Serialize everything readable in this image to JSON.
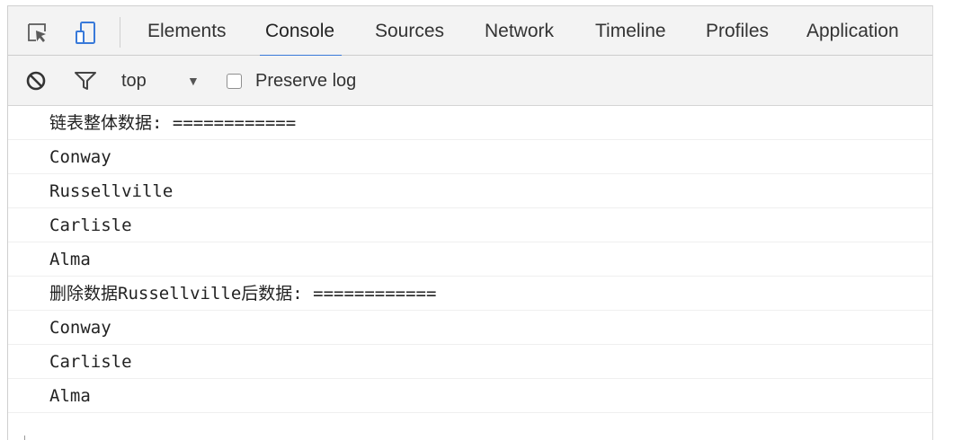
{
  "tabbar": {
    "tabs": [
      {
        "label": "Elements",
        "active": false
      },
      {
        "label": "Console",
        "active": true
      },
      {
        "label": "Sources",
        "active": false
      },
      {
        "label": "Network",
        "active": false
      },
      {
        "label": "Timeline",
        "active": false
      },
      {
        "label": "Profiles",
        "active": false
      },
      {
        "label": "Application",
        "active": false
      }
    ],
    "icons": [
      "inspect-element-icon",
      "device-toggle-icon"
    ],
    "accent_color": "#3879d9"
  },
  "console_toolbar": {
    "context": "top",
    "preserve_log_label": "Preserve log",
    "preserve_log_checked": false,
    "icons": [
      "clear-console-icon",
      "filter-icon",
      "dropdown-arrow-icon"
    ]
  },
  "console": {
    "messages": [
      "链表整体数据: ============",
      "Conway",
      "Russellville",
      "Carlisle",
      "Alma",
      "删除数据Russellville后数据: ============",
      "Conway",
      "Carlisle",
      "Alma"
    ]
  }
}
